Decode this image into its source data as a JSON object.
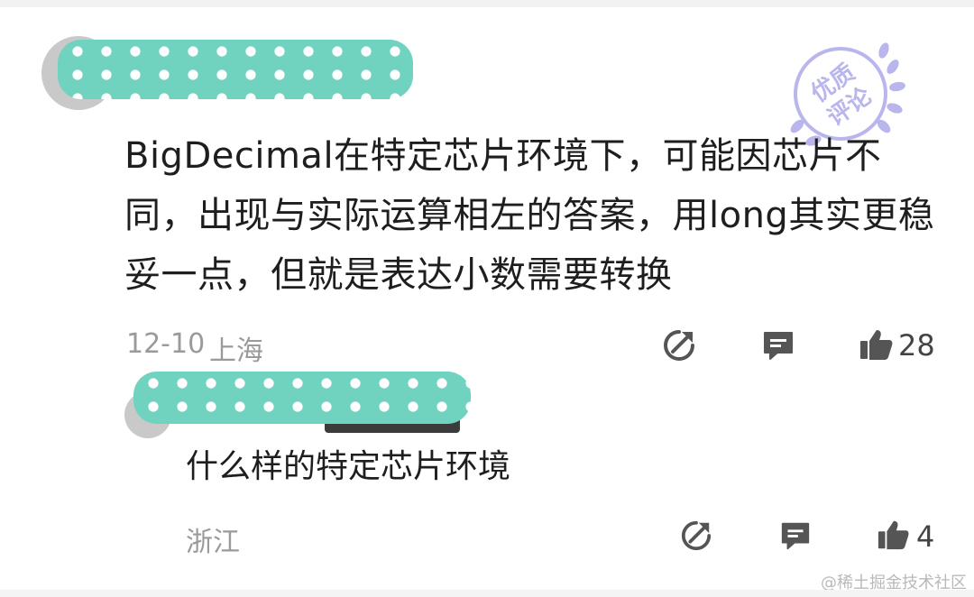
{
  "comment": {
    "text": "BigDecimal在特定芯片环境下，可能因芯片不同，出现与实际运算相左的答案，用long其实更稳妥一点，但就是表达小数需要转换",
    "date": "12-10",
    "location": "上海",
    "likes": "28",
    "badge": {
      "line1": "优质",
      "line2": "评论"
    }
  },
  "reply": {
    "text": "什么样的特定芯片环境",
    "location": "浙江",
    "likes": "4"
  },
  "watermark": "@稀土掘金技术社区",
  "colors": {
    "redaction": "#6fd3bf",
    "badge": "#b8b6ec",
    "icon": "#555555"
  },
  "icons": [
    "share-icon",
    "comment-icon",
    "thumbs-up-icon"
  ]
}
